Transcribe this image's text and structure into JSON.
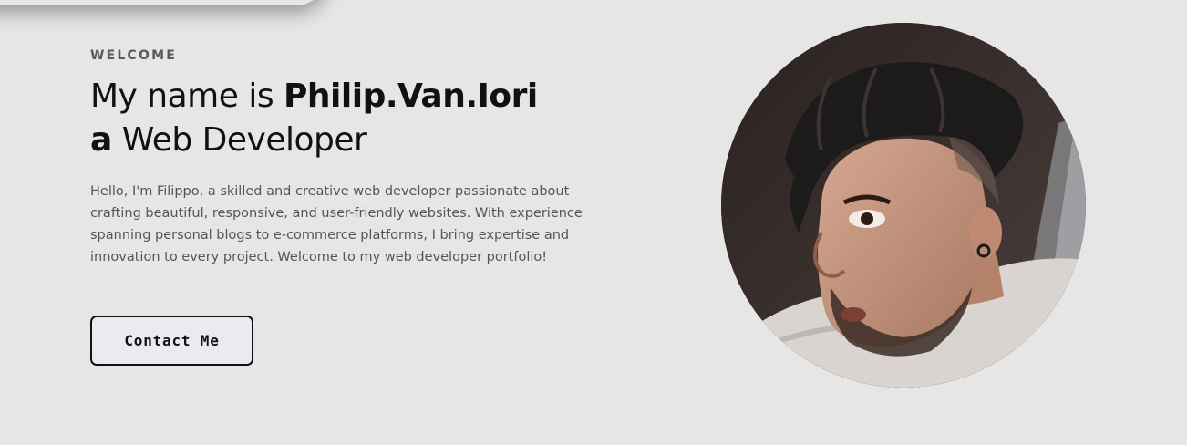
{
  "hero": {
    "eyebrow": "WELCOME",
    "headline_prefix": "My name is ",
    "headline_name": "Philip.Van.Iori",
    "headline_a": "a",
    "headline_role": " Web Developer",
    "bio": "Hello, I'm Filippo, a skilled and creative web developer passionate about crafting beautiful, responsive, and user-friendly websites. With experience spanning personal blogs to e-commerce platforms, I bring expertise and innovation to every project. Welcome to my web developer portfolio!",
    "cta_label": "Contact Me"
  },
  "colors": {
    "background": "#e6e6e6",
    "text_primary": "#111111",
    "text_secondary": "#555555",
    "button_bg": "#ebeaf0"
  }
}
